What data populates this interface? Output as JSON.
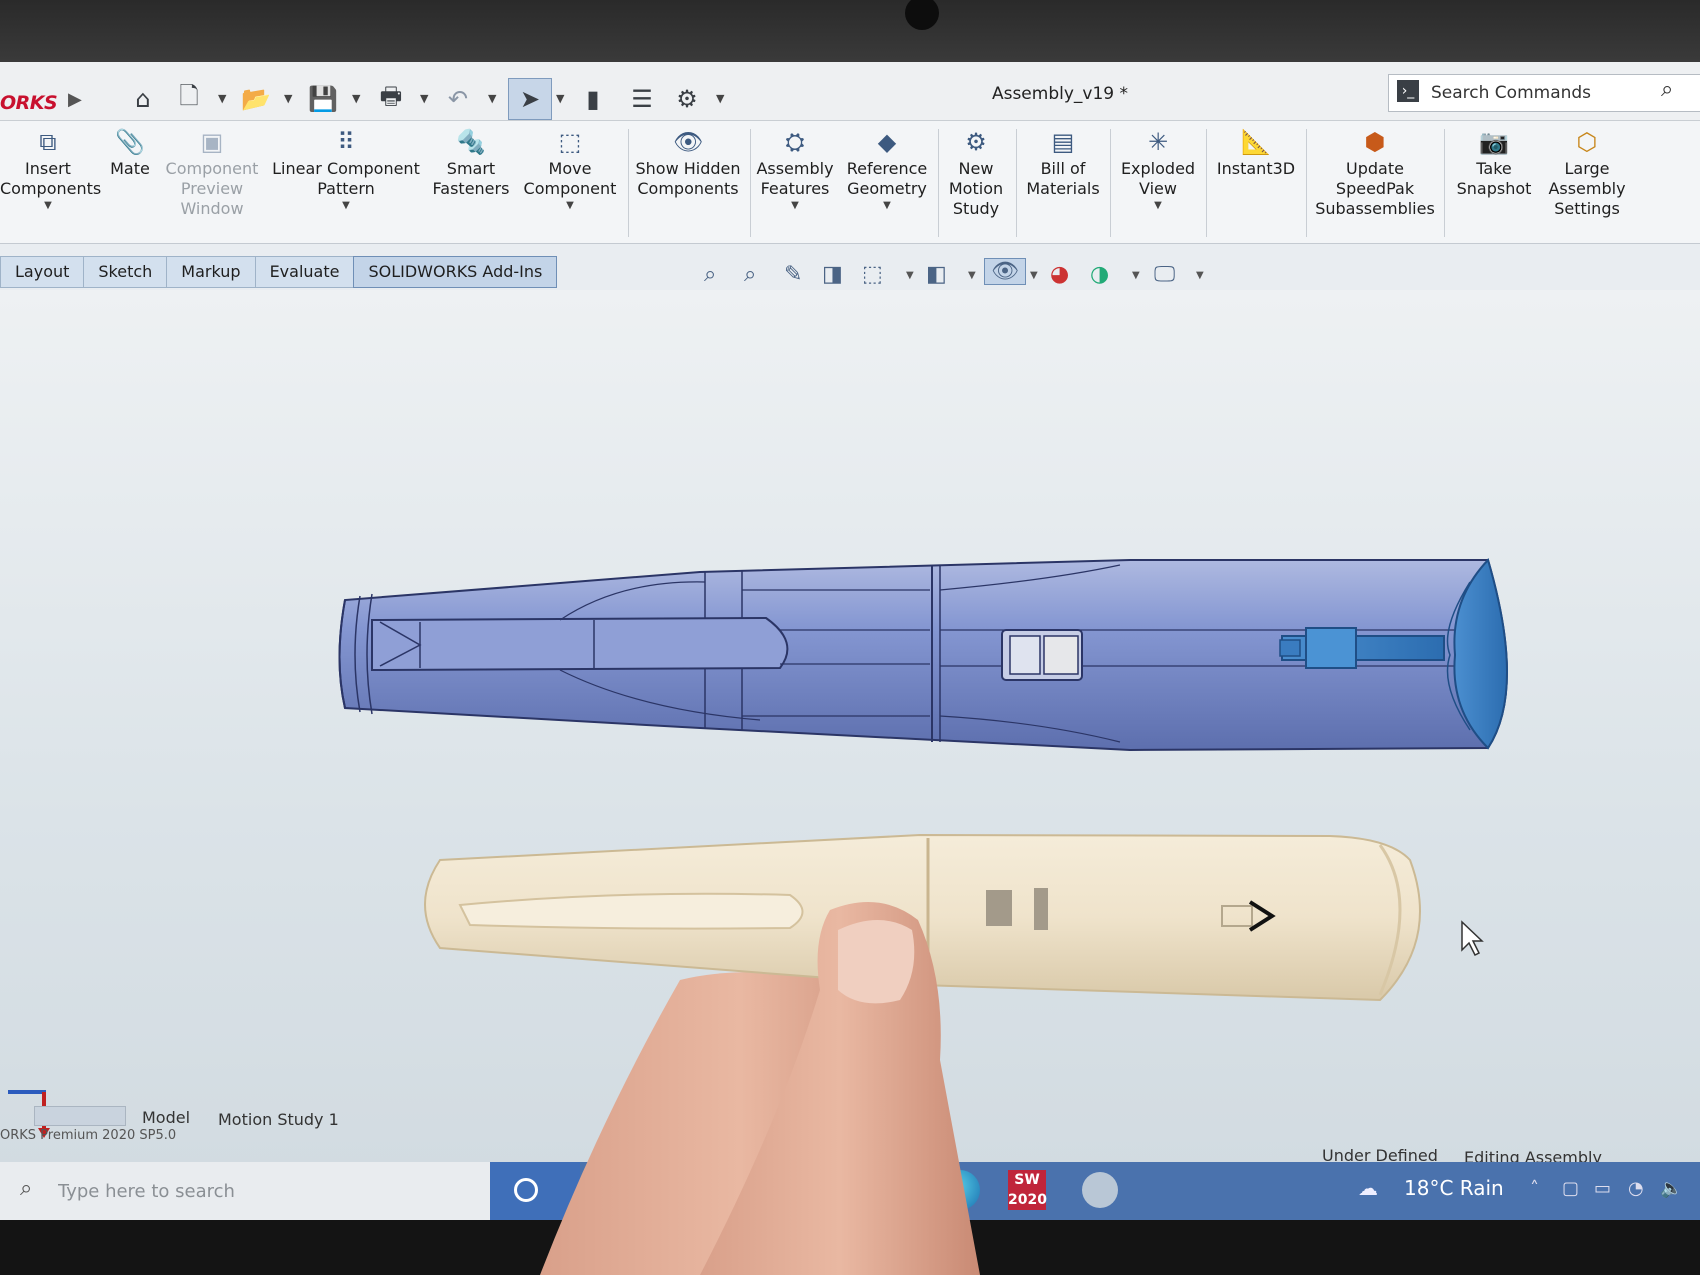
{
  "app": {
    "logo_text": "ORKS",
    "document_title": "Assembly_v19 *",
    "version_text": "ORKS Premium 2020 SP5.0"
  },
  "search": {
    "placeholder": "Search Commands"
  },
  "ribbon": {
    "insert_components": "Insert Components",
    "mate": "Mate",
    "component_preview": "Component Preview Window",
    "linear_pattern": "Linear Component Pattern",
    "smart_fasteners": "Smart Fasteners",
    "move_component": "Move Component",
    "show_hidden": "Show Hidden Components",
    "assembly_features": "Assembly Features",
    "reference_geometry": "Reference Geometry",
    "new_motion_study": "New Motion Study",
    "bill_of_materials": "Bill of Materials",
    "exploded_view": "Exploded View",
    "instant3d": "Instant3D",
    "update_speedpak": "Update SpeedPak Subassemblies",
    "take_snapshot": "Take Snapshot",
    "large_assembly": "Large Assembly Settings"
  },
  "tabs": [
    "Layout",
    "Sketch",
    "Markup",
    "Evaluate",
    "SOLIDWORKS Add-Ins"
  ],
  "model_tabs": {
    "model": "Model",
    "motion_study": "Motion Study 1"
  },
  "status": {
    "under_defined": "Under Defined",
    "editing": "Editing Assembly"
  },
  "taskbar": {
    "search_placeholder": "Type here to search",
    "sw_label": "SW 2020",
    "temperature": "18°C",
    "weather": "Rain"
  },
  "colors": {
    "cad_body": "#7b8fc9",
    "cad_highlight": "#3d8fd6",
    "prototype": "#efe4cf",
    "taskbar_blue": "#4a72ad",
    "brand_red": "#c8102e"
  }
}
